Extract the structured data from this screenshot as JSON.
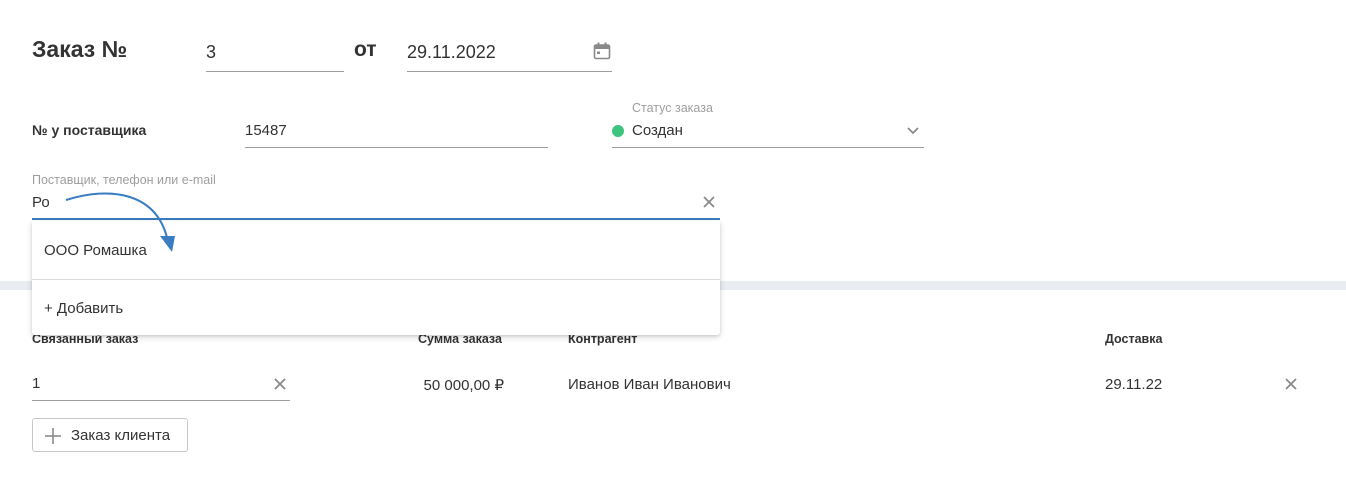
{
  "order": {
    "title": "Заказ №",
    "number": "3",
    "from_label": "от",
    "date": "29.11.2022"
  },
  "supplier_number": {
    "label": "№ у поставщика",
    "value": "15487"
  },
  "status": {
    "label": "Статус заказа",
    "value": "Создан",
    "color": "#3ec47e"
  },
  "supplier": {
    "label": "Поставщик, телефон или e-mail",
    "value": "Ро",
    "accent": "#3a7dc0"
  },
  "dropdown": {
    "items": [
      "ООО Ромашка"
    ],
    "add_label": "+ Добавить"
  },
  "linked_table": {
    "headers": {
      "linked_order": "Связанный заказ",
      "sum": "Сумма заказа",
      "counterparty": "Контрагент",
      "delivery": "Доставка"
    },
    "row": {
      "linked_order": "1",
      "sum": "50 000,00 ₽",
      "counterparty": "Иванов Иван Иванович",
      "delivery": "29.11.22"
    }
  },
  "add_client_order_label": "Заказ клиента",
  "icons": [
    "calendar-icon",
    "chevron-down-icon",
    "clear-icon",
    "plus-icon",
    "remove-icon",
    "arrow-annotation"
  ]
}
